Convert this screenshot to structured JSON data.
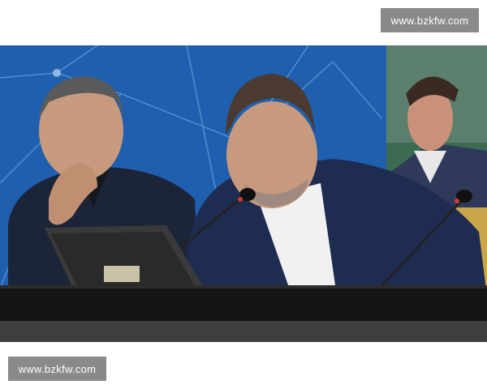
{
  "watermark": {
    "top_text": "www.bzkfw.com",
    "bottom_text": "www.bzkfw.com"
  },
  "photo": {
    "subject": "press-conference-photo",
    "colors": {
      "backdrop": "#1f5fae",
      "backdrop_lines": "#6ea1dc",
      "suit_dark": "#1c2438",
      "suit_navy": "#1f2c52",
      "shirt": "#f1f1f1",
      "skin": "#c79a7e",
      "desk": "#151515",
      "monitor": "#3a3a3a",
      "poster_bg": "#3d6b52"
    }
  }
}
